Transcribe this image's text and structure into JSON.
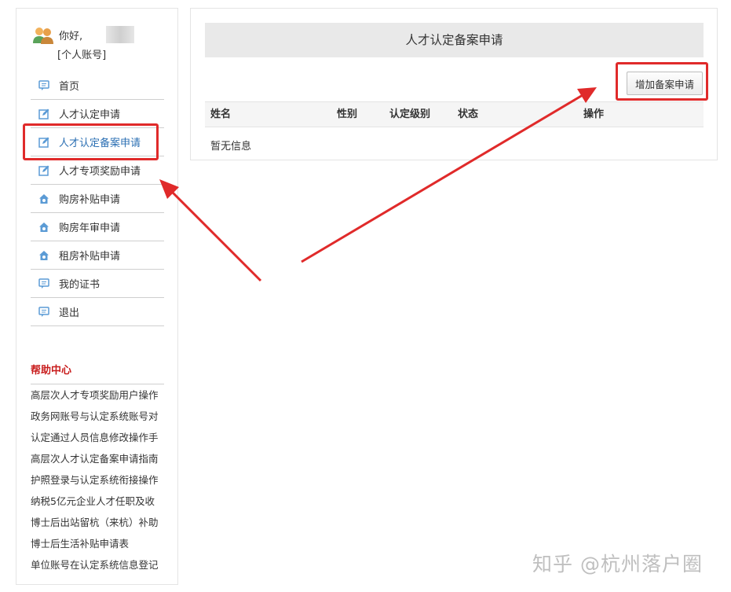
{
  "user": {
    "greeting": "你好,",
    "account_type": "[个人账号]"
  },
  "nav": {
    "items": [
      {
        "label": "首页",
        "icon": "comment-icon"
      },
      {
        "label": "人才认定申请",
        "icon": "edit-icon"
      },
      {
        "label": "人才认定备案申请",
        "icon": "edit-icon",
        "active": true
      },
      {
        "label": "人才专项奖励申请",
        "icon": "edit-icon"
      },
      {
        "label": "购房补贴申请",
        "icon": "house-icon"
      },
      {
        "label": "购房年审申请",
        "icon": "house-icon"
      },
      {
        "label": "租房补贴申请",
        "icon": "house-icon"
      },
      {
        "label": "我的证书",
        "icon": "comment-icon"
      },
      {
        "label": "退出",
        "icon": "comment-icon"
      }
    ]
  },
  "help": {
    "title": "帮助中心",
    "items": [
      "高层次人才专项奖励用户操作",
      "政务网账号与认定系统账号对",
      "认定通过人员信息修改操作手",
      "高层次人才认定备案申请指南",
      "护照登录与认定系统衔接操作",
      "纳税5亿元企业人才任职及收",
      "博士后出站留杭（来杭）补助",
      "博士后生活补贴申请表",
      "单位账号在认定系统信息登记"
    ]
  },
  "main": {
    "title": "人才认定备案申请",
    "add_button": "增加备案申请",
    "columns": {
      "name": "姓名",
      "gender": "性别",
      "level": "认定级别",
      "status": "状态",
      "actions": "操作"
    },
    "empty_text": "暂无信息"
  },
  "colors": {
    "highlight": "#e02a2a",
    "active_link": "#2b6fb3",
    "help_title": "#c81c1c",
    "icon": "#5b9bd5"
  },
  "watermark": "知乎 @杭州落户圈"
}
